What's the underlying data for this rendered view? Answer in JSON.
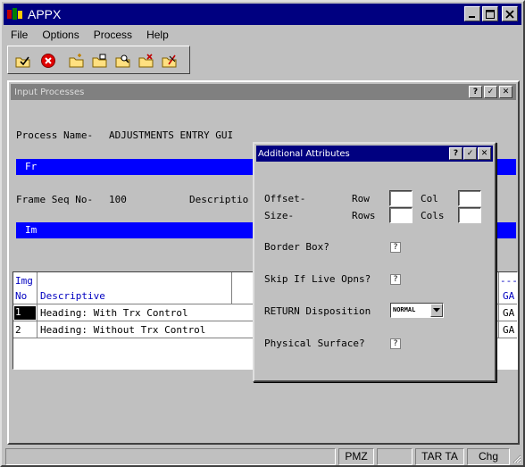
{
  "window": {
    "title": "APPX"
  },
  "menu": [
    "File",
    "Options",
    "Process",
    "Help"
  ],
  "toolbar": {
    "icons": [
      "check-folder-icon",
      "cancel-icon",
      "new-folder-icon",
      "open-folder-icon",
      "find-folder-icon",
      "delete-folder-icon",
      "edit-folder-icon"
    ]
  },
  "child": {
    "title": "Input Processes",
    "buttons": [
      "?",
      "✓",
      "✕"
    ],
    "process_label": "Process Name-",
    "process_value": "ADJUSTMENTS ENTRY GUI",
    "blue1": "Fr",
    "frame_label": "Frame Seq No-",
    "frame_value": "100",
    "description_label": "Descriptio",
    "blue2": "Im",
    "grid": {
      "header_img": "Img",
      "header_no": "No",
      "header_descriptive": "Descriptive",
      "header_dashes": "---",
      "header_ga": "GA",
      "rows": [
        {
          "no": "1",
          "descriptive": "Heading: With Trx Control",
          "ga": "GA"
        },
        {
          "no": "2",
          "descriptive": "Heading: Without Trx Control",
          "ga": "GA"
        }
      ]
    }
  },
  "dialog": {
    "title": "Additional Attributes",
    "buttons": [
      "?",
      "✓",
      "✕"
    ],
    "offset_label": "Offset-",
    "size_label": "Size-",
    "row_label": "Row",
    "rows_label": "Rows",
    "col_label": "Col",
    "cols_label": "Cols",
    "border_box_label": "Border Box?",
    "border_box_value": "?",
    "skip_label": "Skip If Live Opns?",
    "skip_value": "?",
    "return_label": "RETURN Disposition",
    "return_value": "NORMAL",
    "physical_label": "Physical Surface?",
    "physical_value": "?"
  },
  "status": {
    "panels": [
      "",
      "",
      "PMZ",
      "",
      "TAR TA",
      "Chg"
    ]
  }
}
